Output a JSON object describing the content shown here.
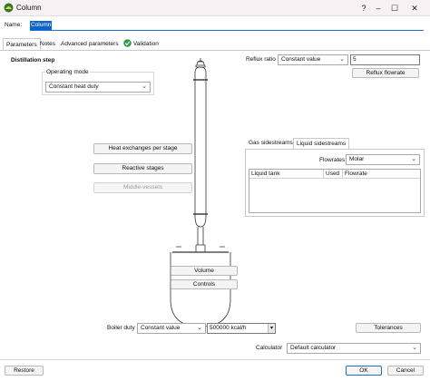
{
  "window": {
    "title": "Column",
    "minimize": "–",
    "maximize": "☐",
    "close": "✕",
    "help": "?"
  },
  "name_row": {
    "label": "Name:",
    "value": "Column"
  },
  "tabs": [
    {
      "label": "Parameters"
    },
    {
      "label": "Notes"
    },
    {
      "label": "Advanced parameters"
    },
    {
      "label": "Validation"
    }
  ],
  "section_title": "Distillation step",
  "operating_mode": {
    "label": "Operating mode",
    "value": "Constant heat duty"
  },
  "left_buttons": {
    "heat_exchanges": "Heat exchanges per stage",
    "reactive_stages": "Reactive stages",
    "middle_vessels": "Middle-vessels"
  },
  "reflux": {
    "label": "Reflux ratio",
    "mode": "Constant value",
    "value": "5",
    "flowrate_button": "Reflux flowrate"
  },
  "sidestreams": {
    "tabs": [
      "Gas sidestreams",
      "Liquid sidestreams"
    ],
    "flowrates_label": "Flowrates",
    "flowrates_value": "Molar",
    "columns": [
      "Liquid tank",
      "Used",
      "Flowrate"
    ]
  },
  "reboiler": {
    "volume_button": "Volume",
    "controls_button": "Controls"
  },
  "boiler_duty": {
    "label": "Boiler duty",
    "mode": "Constant value",
    "value": "500000 kcal/h"
  },
  "tolerances_button": "Tolerances",
  "calculator": {
    "label": "Calculator",
    "value": "Default calculator"
  },
  "footer": {
    "restore": "Restore",
    "ok": "OK",
    "cancel": "Cancel"
  },
  "colors": {
    "accent": "#1a6fd1",
    "validation": "#2f9e44",
    "selection": "#0d63c7"
  }
}
